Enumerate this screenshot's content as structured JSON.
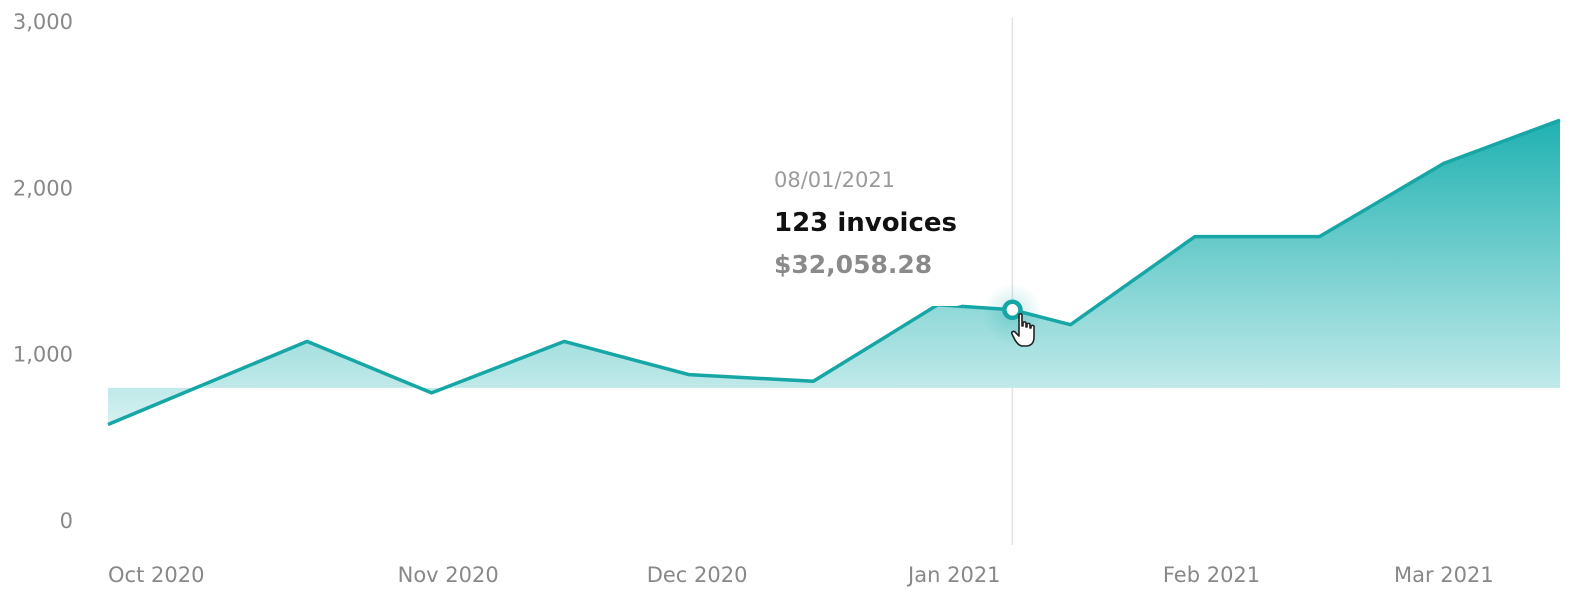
{
  "chart_data": {
    "type": "area",
    "title": "",
    "xlabel": "",
    "ylabel": "",
    "ylim": [
      0,
      3000
    ],
    "yticks": [
      0,
      1000,
      2000,
      3000
    ],
    "ytick_labels": [
      "0",
      "1,000",
      "2,000",
      "3,000"
    ],
    "x_tick_labels": [
      "Oct 2020",
      "Nov 2020",
      "Dec 2020",
      "Jan 2021",
      "Feb 2021",
      "Mar 2021"
    ],
    "x_tick_dates": [
      "2020-10-01",
      "2020-11-01",
      "2020-12-01",
      "2021-01-01",
      "2021-02-01",
      "2021-03-01"
    ],
    "xlim": [
      "2020-09-21",
      "2021-03-15"
    ],
    "grid": false,
    "legend": "none",
    "series": [
      {
        "x": [
          "2020-09-21",
          "2020-10-15",
          "2020-10-30",
          "2020-11-15",
          "2020-11-30",
          "2020-12-15",
          "2020-12-30",
          "2021-01-08",
          "2021-01-15",
          "2021-01-30",
          "2021-02-14",
          "2021-03-01",
          "2021-03-15"
        ],
        "values": [
          580,
          1080,
          770,
          1080,
          880,
          840,
          1300,
          1270,
          1180,
          1710,
          1710,
          2150,
          2410
        ]
      }
    ],
    "highlight": {
      "x": "2021-01-08",
      "value": 1270,
      "date_label": "08/01/2021",
      "count_label": "123 invoices",
      "amount_label": "$32,058.28"
    },
    "colors": {
      "line": "#16a6a6",
      "fill_top": "#20b1b1",
      "fill_bottom": "#d6f1f1",
      "tick_text": "#888888",
      "crosshair": "#e2e2e2"
    }
  }
}
